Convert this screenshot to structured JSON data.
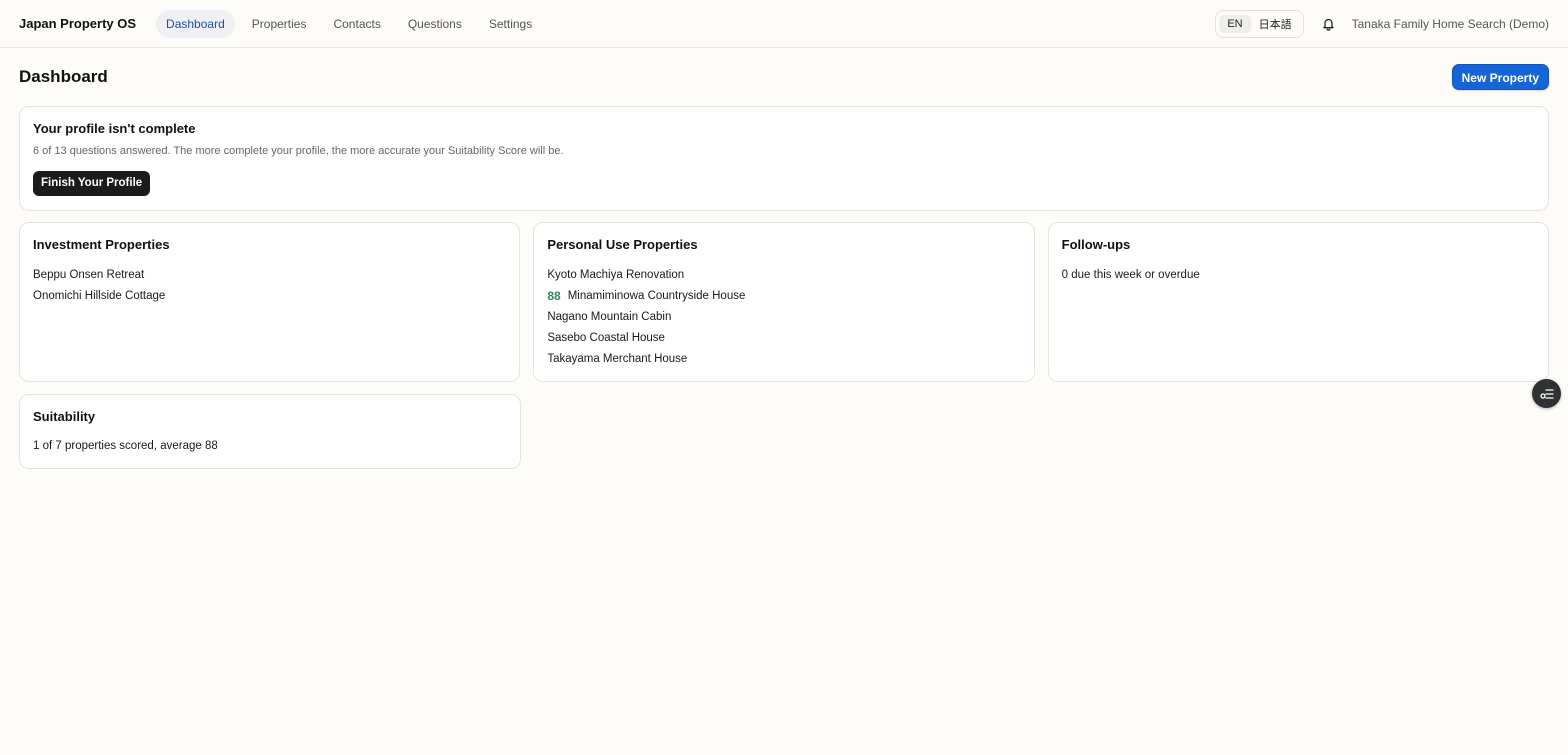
{
  "brand": "Japan Property OS",
  "nav": [
    {
      "label": "Dashboard",
      "active": true
    },
    {
      "label": "Properties",
      "active": false
    },
    {
      "label": "Contacts",
      "active": false
    },
    {
      "label": "Questions",
      "active": false
    },
    {
      "label": "Settings",
      "active": false
    }
  ],
  "lang": {
    "en": "EN",
    "ja": "日本語",
    "active": "EN"
  },
  "account": "Tanaka Family Home Search (Demo)",
  "page": {
    "title": "Dashboard",
    "new_button": "New Property"
  },
  "profile": {
    "title": "Your profile isn't complete",
    "subtitle": "6 of 13 questions answered. The more complete your profile, the more accurate your Suitability Score will be.",
    "button": "Finish Your Profile"
  },
  "investment": {
    "title": "Investment Properties",
    "items": [
      "Beppu Onsen Retreat",
      "Onomichi Hillside Cottage"
    ]
  },
  "personal": {
    "title": "Personal Use Properties",
    "items": [
      {
        "name": "Kyoto Machiya Renovation",
        "score": ""
      },
      {
        "name": "Minamiminowa Countryside House",
        "score": "88"
      },
      {
        "name": "Nagano Mountain Cabin",
        "score": ""
      },
      {
        "name": "Sasebo Coastal House",
        "score": ""
      },
      {
        "name": "Takayama Merchant House",
        "score": ""
      }
    ]
  },
  "followups": {
    "title": "Follow-ups",
    "text": "0 due this week or overdue"
  },
  "suitability": {
    "title": "Suitability",
    "text": "1 of 7 properties scored, average 88"
  },
  "colors": {
    "accent": "#1565d8",
    "score": "#2e8a5a",
    "nav_active": "#1d4fa8"
  }
}
